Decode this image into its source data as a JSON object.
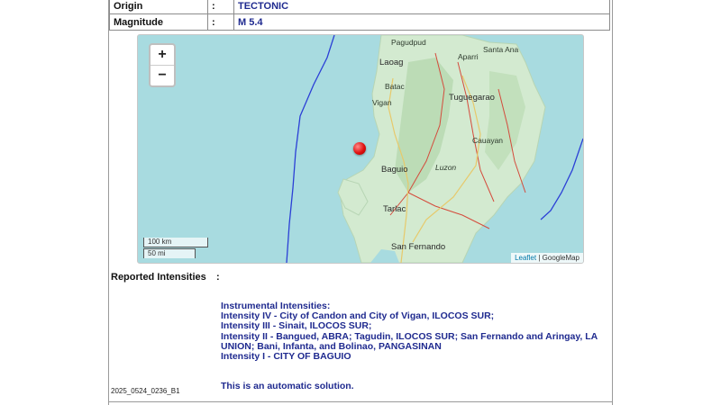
{
  "info": {
    "origin": {
      "label": "Origin",
      "colon": ":",
      "value": "TECTONIC"
    },
    "magnitude": {
      "label": "Magnitude",
      "colon": ":",
      "value": "M 5.4"
    }
  },
  "map": {
    "zoom_in": "+",
    "zoom_out": "−",
    "scale_km": "100 km",
    "scale_mi": "50 mi",
    "attribution_leaflet": "Leaflet",
    "attribution_sep": " | ",
    "attribution_provider": "GoogleMap",
    "places": {
      "pagudpud": "Pagudpud",
      "santa_ana": "Santa Ana",
      "aparri": "Aparri",
      "laoag": "Laoag",
      "batac": "Batac",
      "tuguegarao": "Tuguegarao",
      "vigan": "Vigan",
      "cauayan": "Cauayan",
      "baguio": "Baguio",
      "luzon": "Luzon",
      "tarlac": "Tarlac",
      "san_fernando": "San Fernando"
    }
  },
  "reported": {
    "label": "Reported Intensities",
    "colon": ":"
  },
  "intensities": {
    "header": "Instrumental Intensities:",
    "iv": "Intensity IV - City of Candon and City of Vigan, ILOCOS SUR;",
    "iii": "Intensity III - Sinait, ILOCOS SUR;",
    "ii": "Intensity II - Bangued, ABRA; Tagudin, ILOCOS SUR; San Fernando and Aringay, LA UNION; Bani, Infanta, and Bolinao, PANGASINAN",
    "i": "Intensity I - CITY OF BAGUIO"
  },
  "automatic_note": "This is an automatic solution.",
  "event_id": "2025_0524_0236_B1"
}
